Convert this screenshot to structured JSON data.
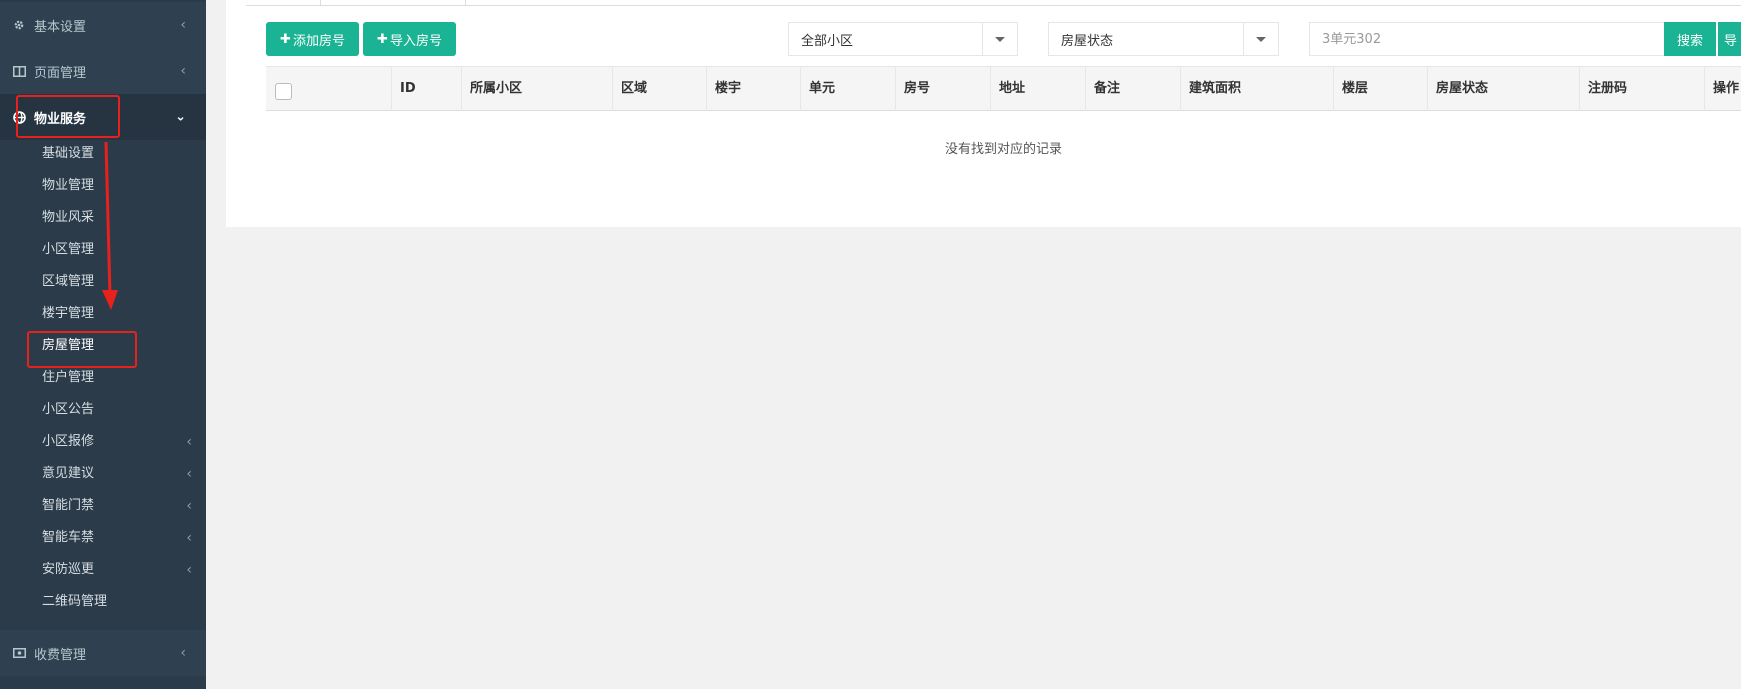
{
  "sidebar": {
    "top_items": [
      {
        "label": "基本设置",
        "icon": "gear-icon"
      },
      {
        "label": "页面管理",
        "icon": "columns-icon"
      },
      {
        "label": "物业服务",
        "icon": "globe-icon"
      }
    ],
    "sub_items": [
      {
        "label": "基础设置",
        "has_children": false
      },
      {
        "label": "物业管理",
        "has_children": false
      },
      {
        "label": "物业风采",
        "has_children": false
      },
      {
        "label": "小区管理",
        "has_children": false
      },
      {
        "label": "区域管理",
        "has_children": false
      },
      {
        "label": "楼宇管理",
        "has_children": false
      },
      {
        "label": "房屋管理",
        "has_children": false
      },
      {
        "label": "住户管理",
        "has_children": false
      },
      {
        "label": "小区公告",
        "has_children": false
      },
      {
        "label": "小区报修",
        "has_children": true
      },
      {
        "label": "意见建议",
        "has_children": true
      },
      {
        "label": "智能门禁",
        "has_children": true
      },
      {
        "label": "智能车禁",
        "has_children": true
      },
      {
        "label": "安防巡更",
        "has_children": true
      },
      {
        "label": "二维码管理",
        "has_children": false
      }
    ],
    "bottom_item": {
      "label": "收费管理",
      "icon": "money-icon"
    },
    "chevron_left": "‹",
    "chevron_down": "⌄"
  },
  "toolbar": {
    "add_label": "添加房号",
    "import_label": "导入房号",
    "plus": "✚",
    "community_select": "全部小区",
    "status_select": "房屋状态",
    "search_placeholder": "3单元302",
    "search_label": "搜索",
    "export_label": "导"
  },
  "table": {
    "columns": [
      "ID",
      "所属小区",
      "区域",
      "楼宇",
      "单元",
      "房号",
      "地址",
      "备注",
      "建筑面积",
      "楼层",
      "房屋状态",
      "注册码",
      "操作"
    ],
    "empty_message": "没有找到对应的记录"
  },
  "colors": {
    "sidebar_bg": "#2c3b4a",
    "accent_green": "#1ab394",
    "annotation_red": "#e8211c"
  }
}
